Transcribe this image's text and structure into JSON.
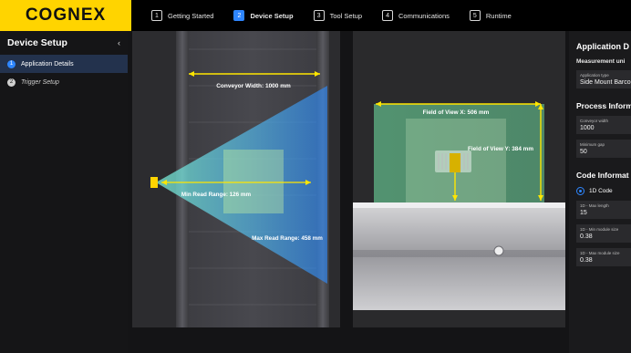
{
  "app": {
    "logo": "COGNEX"
  },
  "steps": [
    {
      "num": "1",
      "label": "Getting Started",
      "active": false
    },
    {
      "num": "2",
      "label": "Device Setup",
      "active": true
    },
    {
      "num": "3",
      "label": "Tool Setup",
      "active": false
    },
    {
      "num": "4",
      "label": "Communications",
      "active": false
    },
    {
      "num": "5",
      "label": "Runtime",
      "active": false
    }
  ],
  "sidebar": {
    "title": "Device Setup",
    "collapse_icon": "chevron-left-icon",
    "items": [
      {
        "num": "1",
        "label": "Application Details",
        "active": true
      },
      {
        "num": "2",
        "label": "Trigger Setup",
        "active": false
      }
    ]
  },
  "left_view": {
    "conveyor_width": "Conveyor Width: 1000 mm",
    "min_read_range": "Min Read Range: 126 mm",
    "max_read_range": "Max Read Range: 458 mm"
  },
  "right_view": {
    "fov_x": "Field of View X: 506 mm",
    "fov_y": "Field of View Y: 384 mm"
  },
  "right_panel": {
    "title": "Application D",
    "measurement": "Measurement uni",
    "app_type_label": "Application type",
    "app_type_value": "Side Mount Barco",
    "process_title": "Process Inform",
    "conveyor_label": "Conveyor width",
    "conveyor_value": "1000",
    "gap_label": "Minimum gap",
    "gap_value": "50",
    "code_title": "Code Informat",
    "radio_label": "1D Code",
    "max_length_label": "1D - Max length",
    "max_length_value": "15",
    "min_module_label": "1D - Min module size",
    "min_module_value": "0.38",
    "max_module_label": "1D - Max module size",
    "max_module_value": "0.38"
  },
  "colors": {
    "accent_blue": "#2e86ff",
    "brand_yellow": "#ffd400",
    "dimension_yellow": "#ffe600"
  }
}
